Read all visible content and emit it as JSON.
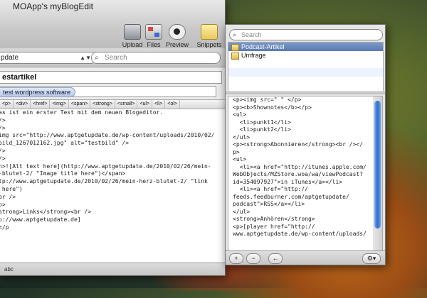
{
  "window": {
    "title": "MOApp's myBlogEdit"
  },
  "toolbar": {
    "upload_label": "Upload",
    "files_label": "Files",
    "preview_label": "Preview",
    "snippets_label": "Snippets"
  },
  "blog_select": {
    "value": "pdate"
  },
  "search_main": {
    "placeholder": "Search"
  },
  "post": {
    "title": "estartikel",
    "tag": "test wordpress software"
  },
  "html_buttons": [
    "<p>",
    "<div>",
    "<href>",
    "<img>",
    "<span>",
    "<strong>",
    "<small>",
    "<ul>",
    "<li>",
    "<ol>"
  ],
  "editor_lines": [
    "as ist ein erster Test mit dem neuen Blogeditor.",
    "/>",
    "/>",
    "img src=\"http://www.aptgetupdate.de/wp-content/uploads/2010/02/",
    "bild_1267012162.jpg\" alt=\"testbild\" />",
    "",
    "",
    "/>",
    "/>",
    "n>![Alt text here](http://www.aptgetupdate.de/2010/02/26/mein-",
    "-blutet-2/ \"Image title here\")</span>",
    "",
    "tp://www.aptgetupdate.de/2010/02/26/mein-herz-blutet-2/ \"link",
    " here\")",
    "",
    "br />",
    "p>",
    "",
    "",
    "strong>Links</strong><br />",
    "p://www.aptgetupdate.de]",
    "</p"
  ],
  "status": {
    "text": "abc"
  },
  "side": {
    "search_placeholder": "Search",
    "items": [
      {
        "label": "Podcast-Artikel"
      },
      {
        "label": "Umfrage"
      }
    ],
    "code_lines": [
      "<p><img src=\" \" </p>",
      "<p><b>Shownotes</b></p>",
      "<ul>",
      "  <li>punkt1</li>",
      "",
      "  <li>punkt2</li>",
      "</ul>",
      "",
      "<p><strong>Abonnieren</strong><br /></",
      "p>",
      "",
      "<ul>",
      "  <li><a href=\"http://itunes.apple.com/",
      "WebObjects/MZStore.woa/wa/viewPodcast?",
      "id=354097927\">in iTunes</a></li>",
      "",
      "  <li><a href=\"http://",
      "feeds.feedburner.com/aptgetupdate/",
      "podcast\">RSS</a></li>",
      "</ul>",
      "",
      "<strong>Anhören</strong>",
      "<p>[player href=\"http://",
      "www.aptgetupdate.de/wp-content/uploads/"
    ],
    "add_label": "+",
    "remove_label": "−",
    "back_label": "←",
    "gear_label": "⚙▾"
  }
}
